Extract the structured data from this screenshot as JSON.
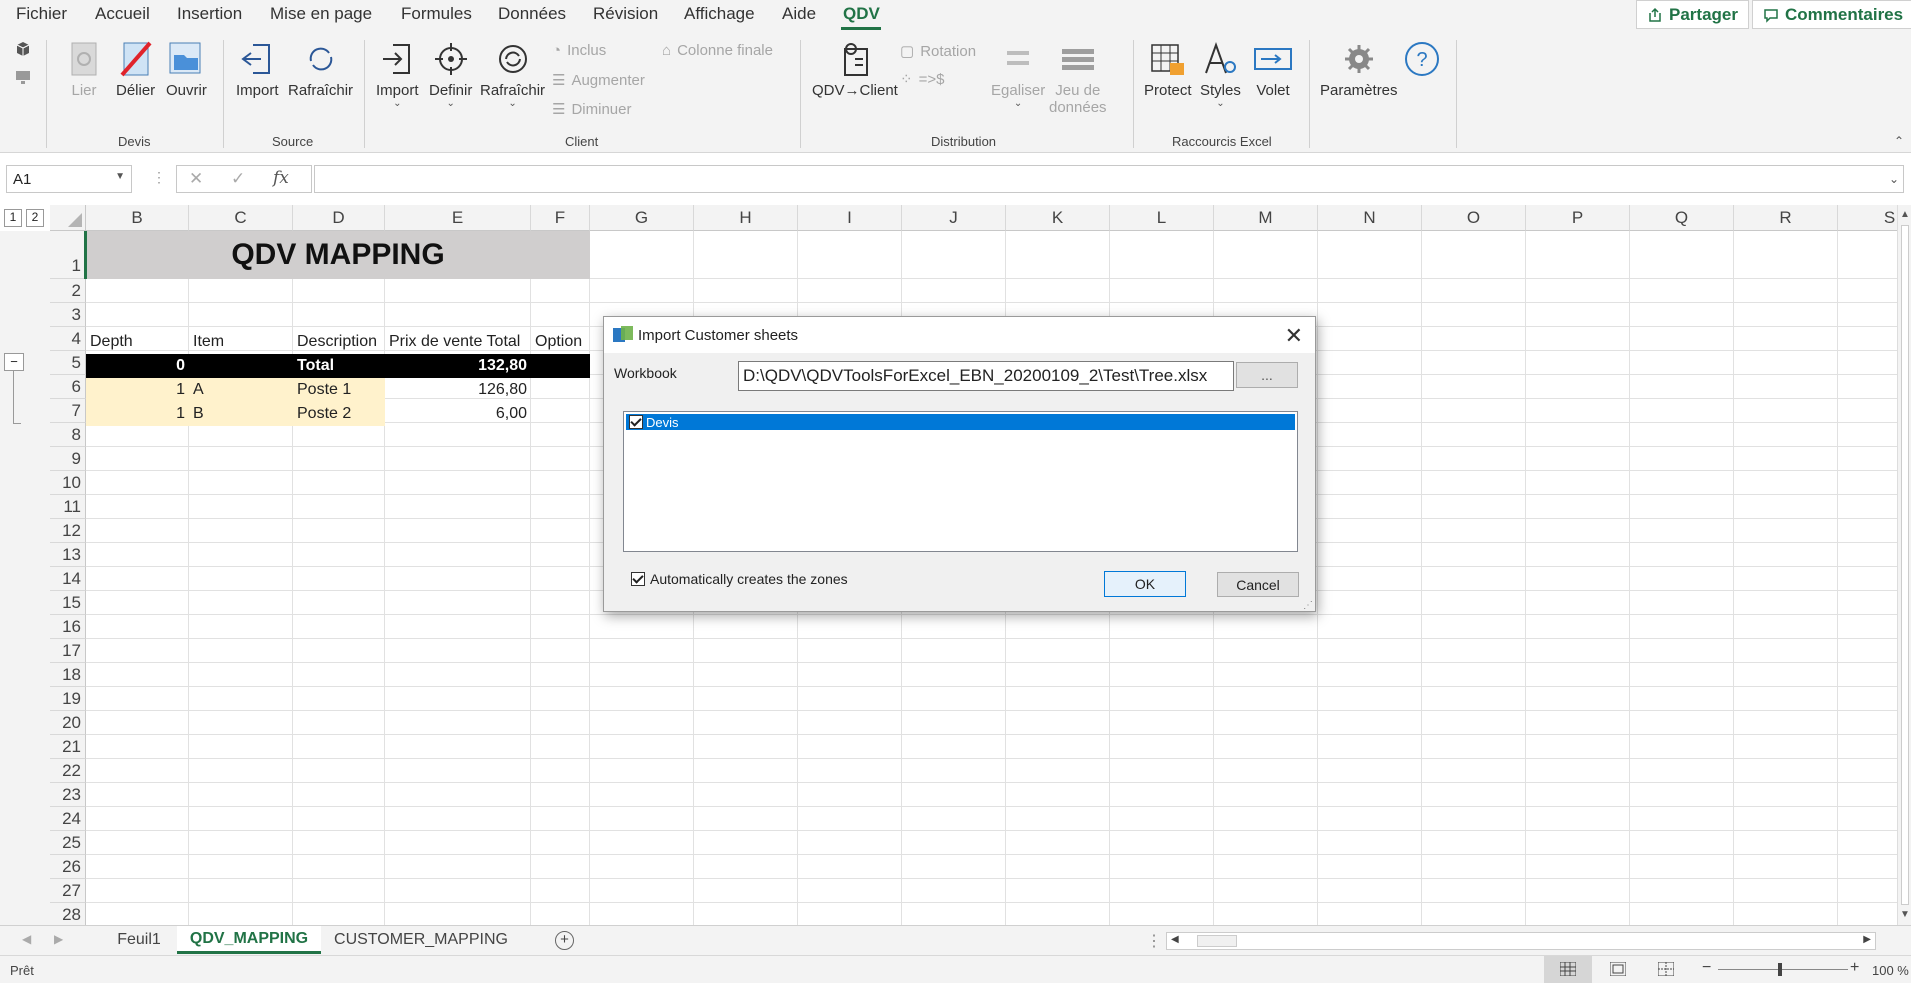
{
  "menu": {
    "items": [
      "Fichier",
      "Accueil",
      "Insertion",
      "Mise en page",
      "Formules",
      "Données",
      "Révision",
      "Affichage",
      "Aide",
      "QDV"
    ],
    "active": "QDV",
    "share": "Partager",
    "comments": "Commentaires"
  },
  "ribbon": {
    "devis": {
      "lier": "Lier",
      "delier": "Délier",
      "ouvrir": "Ouvrir",
      "label": "Devis"
    },
    "source": {
      "import": "Import",
      "rafraichir": "Rafraîchir",
      "label": "Source"
    },
    "client": {
      "import": "Import",
      "definir": "Definir",
      "rafraichir": "Rafraîchir",
      "inclus": "Inclus",
      "augmenter": "Augmenter",
      "diminuer": "Diminuer",
      "colonne_finale": "Colonne finale",
      "label": "Client"
    },
    "distribution": {
      "qdv_client": "QDV→Client",
      "rotation": "Rotation",
      "arrow_dollar": "=>$",
      "egaliser": "Egaliser",
      "jeu1": "Jeu de",
      "jeu2": "données",
      "label": "Distribution"
    },
    "raccourcis": {
      "protect": "Protect",
      "styles": "Styles",
      "volet": "Volet",
      "label": "Raccourcis Excel"
    },
    "parametres": "Paramètres"
  },
  "formula_bar": {
    "name_box": "A1",
    "value": ""
  },
  "columns": [
    "B",
    "C",
    "D",
    "E",
    "F",
    "G",
    "H",
    "I",
    "J",
    "K",
    "L",
    "M",
    "N",
    "O",
    "P",
    "Q",
    "R",
    "S"
  ],
  "rows": [
    "1",
    "2",
    "3",
    "4",
    "5",
    "6",
    "7",
    "8",
    "9",
    "10",
    "11",
    "12",
    "13",
    "14",
    "15",
    "16",
    "17",
    "18",
    "19",
    "20",
    "21",
    "22",
    "23",
    "24",
    "25",
    "26",
    "27",
    "28"
  ],
  "outline_levels": [
    "1",
    "2"
  ],
  "outline_toggle": "−",
  "sheet": {
    "title": "QDV MAPPING",
    "headers": [
      "Depth",
      "Item",
      "Description",
      "Prix de vente Total",
      "Option"
    ],
    "total_row": {
      "depth": "0",
      "item": "",
      "description": "Total",
      "price": "132,80"
    },
    "rows": [
      {
        "depth": "1",
        "item": "A",
        "description": "Poste 1",
        "price": "126,80"
      },
      {
        "depth": "1",
        "item": "B",
        "description": "Poste 2",
        "price": "6,00"
      }
    ]
  },
  "dialog": {
    "title": "Import Customer sheets",
    "workbook_label": "Workbook",
    "workbook_path": "D:\\QDV\\QDVToolsForExcel_EBN_20200109_2\\Test\\Tree.xlsx",
    "browse_label": "...",
    "sheets": [
      {
        "name": "Devis",
        "checked": true
      }
    ],
    "auto_zones_label": "Automatically creates the zones",
    "ok_label": "OK",
    "cancel_label": "Cancel"
  },
  "tabs": [
    "Feuil1",
    "QDV_MAPPING",
    "CUSTOMER_MAPPING"
  ],
  "active_tab": "QDV_MAPPING",
  "status": {
    "text": "Prêt",
    "zoom": "100 %"
  },
  "colors": {
    "accent": "#217346",
    "selection": "#0078d7",
    "total_bg": "#000000",
    "item_bg": "#fff2cc",
    "title_bg": "#d0cece"
  }
}
